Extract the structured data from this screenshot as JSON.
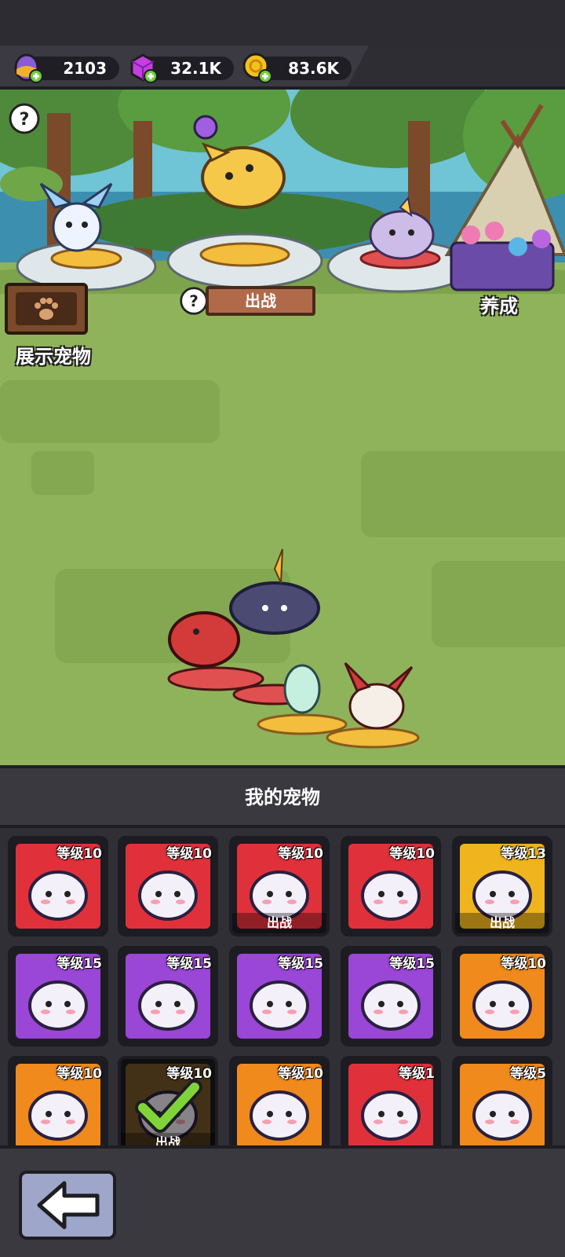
{
  "resources": {
    "eggs": "2103",
    "gems": "32.1K",
    "coins": "83.6K"
  },
  "scene": {
    "show_pets_label": "展示宠物",
    "deploy_label": "出战",
    "nurture_label": "养成"
  },
  "panel": {
    "title": "我的宠物"
  },
  "pets": [
    {
      "level": "等级10",
      "status": "",
      "bg": "#e0313b"
    },
    {
      "level": "等级10",
      "status": "",
      "bg": "#e0313b"
    },
    {
      "level": "等级10",
      "status": "出战",
      "bg": "#e0313b"
    },
    {
      "level": "等级10",
      "status": "",
      "bg": "#e0313b"
    },
    {
      "level": "等级13",
      "status": "出战",
      "bg": "#f0b51e"
    },
    {
      "level": "等级15",
      "status": "",
      "bg": "#9a46d6"
    },
    {
      "level": "等级15",
      "status": "",
      "bg": "#9a46d6"
    },
    {
      "level": "等级15",
      "status": "",
      "bg": "#9a46d6"
    },
    {
      "level": "等级15",
      "status": "",
      "bg": "#9a46d6"
    },
    {
      "level": "等级10",
      "status": "",
      "bg": "#f08a1c"
    },
    {
      "level": "等级10",
      "status": "",
      "bg": "#f08a1c"
    },
    {
      "level": "等级10",
      "status": "出战",
      "bg": "#7a5a2a"
    },
    {
      "level": "等级10",
      "status": "",
      "bg": "#f08a1c"
    },
    {
      "level": "等级1",
      "status": "",
      "bg": "#e0313b"
    },
    {
      "level": "等级5",
      "status": "",
      "bg": "#f08a1c"
    }
  ],
  "colors": {
    "rare_red": "#e0313b",
    "epic_purple": "#9a46d6",
    "common_orange": "#f08a1c",
    "legend_gold": "#f0b51e"
  }
}
